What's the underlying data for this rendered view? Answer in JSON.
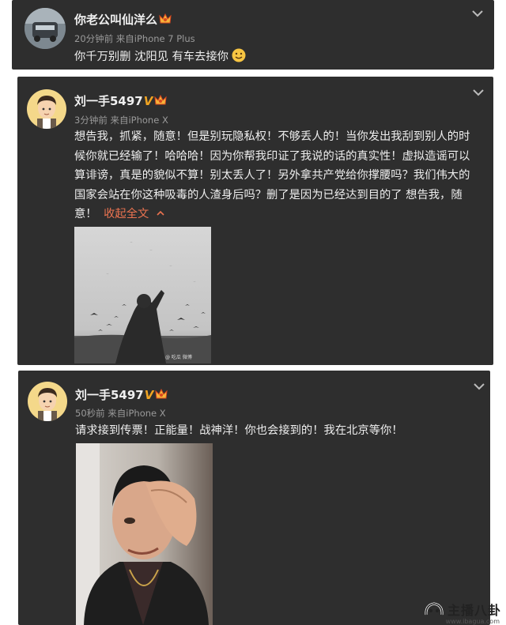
{
  "posts": [
    {
      "username": "你老公叫仙洋么",
      "meta": "20分钟前 来自iPhone 7 Plus",
      "text": "你千万别删 沈阳见 有车去接你"
    },
    {
      "username": "刘一手5497",
      "meta": "3分钟前 来自iPhone X",
      "lines": [
        "想告我，抓紧，随意！但是别玩隐私权！不够丢人的！当你发出我刮到别人的时",
        "候你就已经输了！哈哈哈！因为你帮我印证了我说的话的真实性！虚拟造谣可以",
        "算诽谤，真是的貌似不算！别太丢人了！另外拿共产党给你撑腰吗？我们伟大的",
        "国家会站在你这种吸毒的人渣身后吗？删了是因为已经达到目的了 想告我，随",
        "意！"
      ],
      "collapse_link": "收起全文",
      "image_caption": "@ 吃瓜 微博"
    },
    {
      "username": "刘一手5497",
      "meta": "50秒前 来自iPhone X",
      "text": "请求接到传票！正能量！战神洋！你也会接到的！我在北京等你！"
    }
  ],
  "verified_badge": "V",
  "watermark": {
    "title": "主播八卦",
    "url": "www.ibagua.com"
  },
  "colors": {
    "card_bg": "#2e2e2e",
    "link": "#eb7350",
    "badge": "#f0a422"
  }
}
